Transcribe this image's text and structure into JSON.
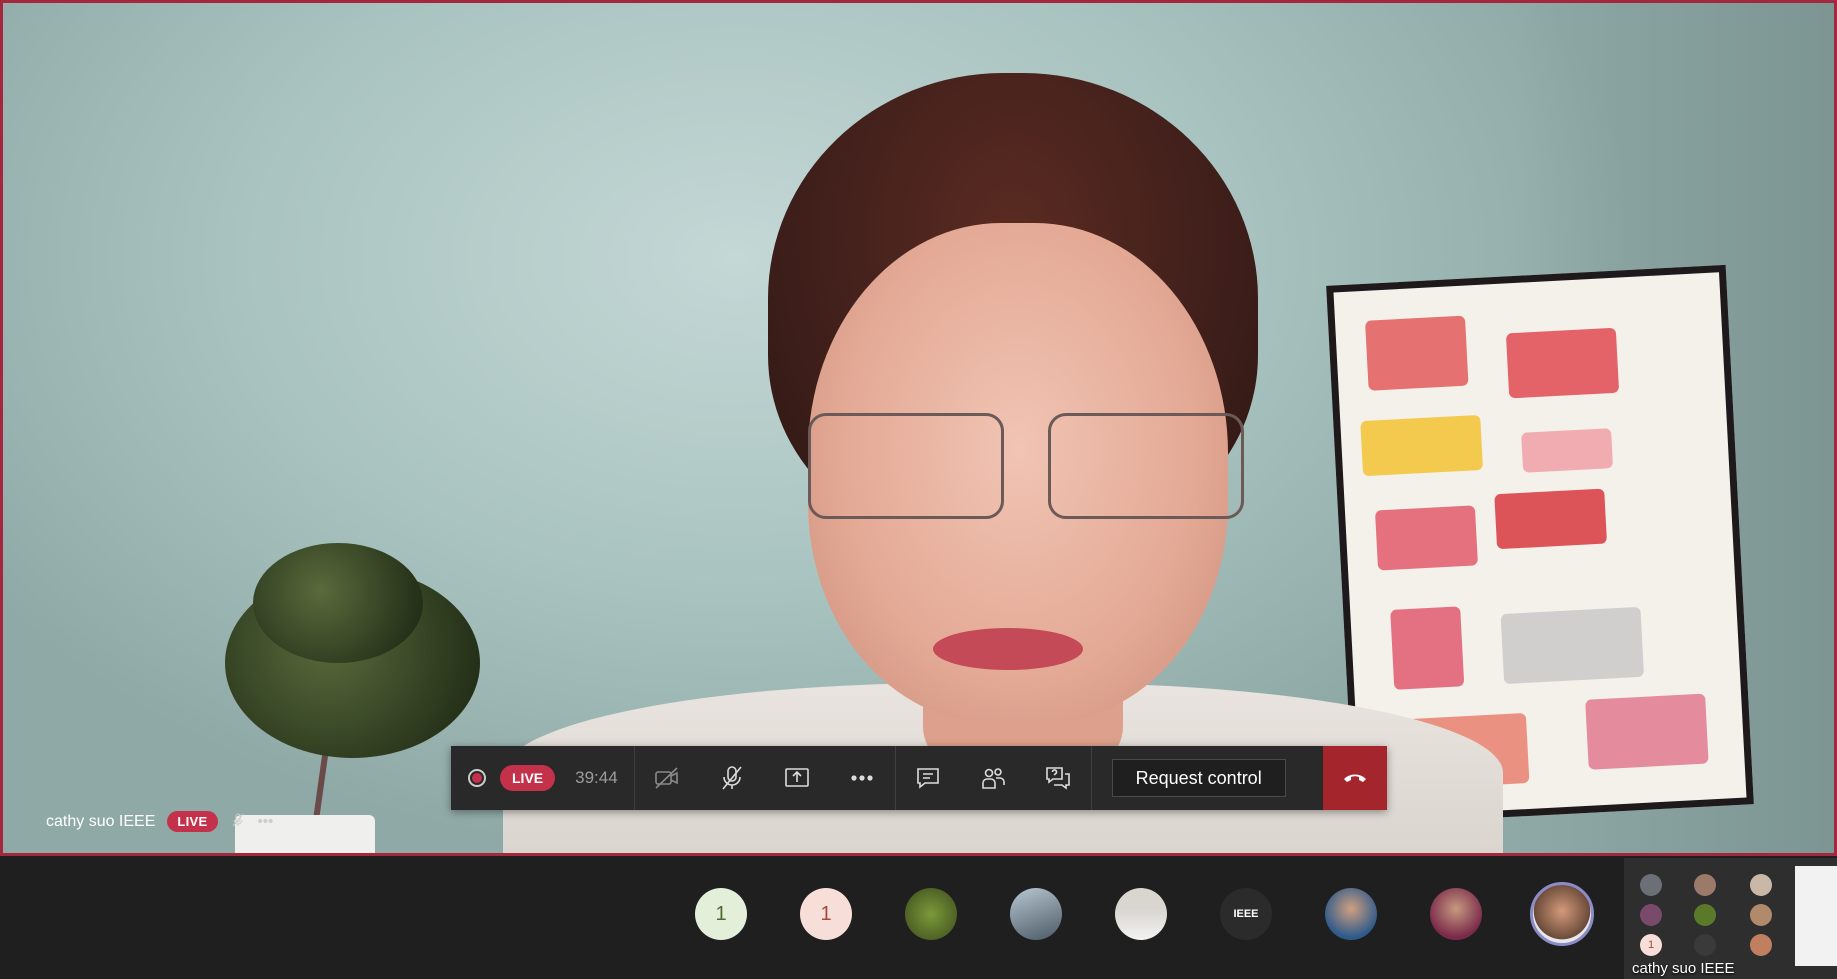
{
  "speaker": {
    "name": "cathy suo IEEE",
    "live_badge": "LIVE",
    "mic_icon": "mic-off-icon",
    "more_icon": "more-icon"
  },
  "control_bar": {
    "live_badge": "LIVE",
    "elapsed_time": "39:44",
    "icons": [
      "record-icon",
      "camera-off-icon",
      "mic-off-icon",
      "share-screen-icon",
      "more-options-icon",
      "chat-icon",
      "participants-icon",
      "qa-icon",
      "hang-up-icon"
    ],
    "request_control_label": "Request control"
  },
  "participants": [
    {
      "type": "count",
      "label": "1"
    },
    {
      "type": "count",
      "label": "1"
    },
    {
      "type": "photo",
      "label": ""
    },
    {
      "type": "photo",
      "label": ""
    },
    {
      "type": "photo",
      "label": ""
    },
    {
      "type": "logo",
      "label": "IEEE"
    },
    {
      "type": "photo",
      "label": ""
    },
    {
      "type": "photo",
      "label": ""
    },
    {
      "type": "photo",
      "label": "",
      "active": true
    }
  ],
  "preview": {
    "name": "cathy suo IEEE",
    "count": "1"
  },
  "colors": {
    "live_red": "#c4314b",
    "hangup_red": "#a4262c",
    "bar_bg": "#292929",
    "active_ring": "#8b8cc7"
  }
}
